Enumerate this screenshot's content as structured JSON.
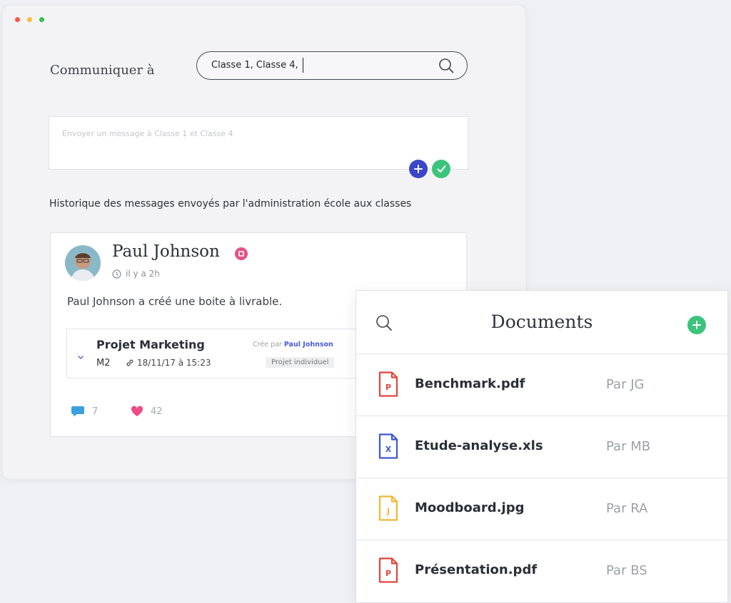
{
  "composer": {
    "to_label": "Communiquer à",
    "recipients_value": "Classe 1, Classe 4,",
    "message_placeholder": "Envoyer un message à Classe 1 et Classe 4"
  },
  "history_title": "Historique des messages envoyés par l'administration école aux classes",
  "post": {
    "author": "Paul Johnson",
    "time": "il y a 2h",
    "text": "Paul Johnson a créé une boite à livrable.",
    "project": {
      "title": "Projet Marketing",
      "code": "M2",
      "date": "18/11/17 à 15:23",
      "created_prefix": "Crée par",
      "created_by": "Paul Johnson",
      "tag": "Projet individuel"
    },
    "comments_count": "7",
    "likes_count": "42"
  },
  "documents": {
    "title": "Documents",
    "items": [
      {
        "name": "Benchmark.pdf",
        "by": "Par JG",
        "letter": "P",
        "color": "#e2453c"
      },
      {
        "name": "Etude-analyse.xls",
        "by": "Par MB",
        "letter": "X",
        "color": "#3d57d6"
      },
      {
        "name": "Moodboard.jpg",
        "by": "Par RA",
        "letter": "J",
        "color": "#f2b632"
      },
      {
        "name": "Présentation.pdf",
        "by": "Par BS",
        "letter": "P",
        "color": "#e2453c"
      }
    ]
  },
  "colors": {
    "accent_blue": "#4a5bd8",
    "accent_green": "#3cc47c",
    "badge_pink": "#e74f87"
  }
}
